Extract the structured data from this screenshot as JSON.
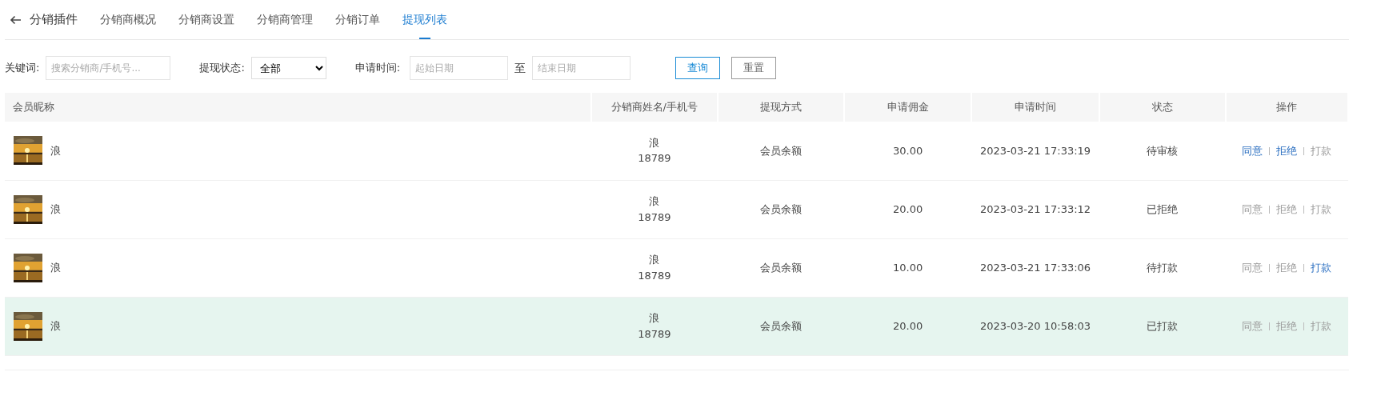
{
  "header": {
    "back_label": "分销插件",
    "tabs": [
      {
        "label": "分销商概况",
        "selected": false
      },
      {
        "label": "分销商设置",
        "selected": false
      },
      {
        "label": "分销商管理",
        "selected": false
      },
      {
        "label": "分销订单",
        "selected": false
      },
      {
        "label": "提现列表",
        "selected": true
      }
    ]
  },
  "filters": {
    "keyword_label": "关键词:",
    "keyword": {
      "placeholder": "搜索分销商/手机号..."
    },
    "status_label": "提现状态:",
    "status_value": "全部",
    "time_label": "申请时间:",
    "start": {
      "placeholder": "起始日期"
    },
    "range_sep": "至",
    "end": {
      "placeholder": "结束日期"
    },
    "buttons": [
      {
        "label": "查询",
        "kind": "primary"
      },
      {
        "label": "重置",
        "kind": "default"
      }
    ]
  },
  "table": {
    "columns": [
      "会员昵称",
      "分销商姓名/手机号",
      "提现方式",
      "申请佣金",
      "申请时间",
      "状态",
      "操作"
    ],
    "rows": [
      {
        "nickname": "浪",
        "name": "浪",
        "phone": "18789",
        "method": "会员余额",
        "amount": "30.00",
        "time": "2023-03-21 17:33:19",
        "status": "待审核",
        "highlighted": false,
        "actions": [
          {
            "label": "同意",
            "disabled": false
          },
          {
            "label": "拒绝",
            "disabled": false
          },
          {
            "label": "打款",
            "disabled": true
          }
        ]
      },
      {
        "nickname": "浪",
        "name": "浪",
        "phone": "18789",
        "method": "会员余额",
        "amount": "20.00",
        "time": "2023-03-21 17:33:12",
        "status": "已拒绝",
        "highlighted": false,
        "actions": [
          {
            "label": "同意",
            "disabled": true
          },
          {
            "label": "拒绝",
            "disabled": true
          },
          {
            "label": "打款",
            "disabled": true
          }
        ]
      },
      {
        "nickname": "浪",
        "name": "浪",
        "phone": "18789",
        "method": "会员余额",
        "amount": "10.00",
        "time": "2023-03-21 17:33:06",
        "status": "待打款",
        "highlighted": false,
        "actions": [
          {
            "label": "同意",
            "disabled": true
          },
          {
            "label": "拒绝",
            "disabled": true
          },
          {
            "label": "打款",
            "disabled": false
          }
        ]
      },
      {
        "nickname": "浪",
        "name": "浪",
        "phone": "18789",
        "method": "会员余额",
        "amount": "20.00",
        "time": "2023-03-20 10:58:03",
        "status": "已打款",
        "highlighted": true,
        "actions": [
          {
            "label": "同意",
            "disabled": true
          },
          {
            "label": "拒绝",
            "disabled": true
          },
          {
            "label": "打款",
            "disabled": true
          }
        ]
      }
    ]
  }
}
